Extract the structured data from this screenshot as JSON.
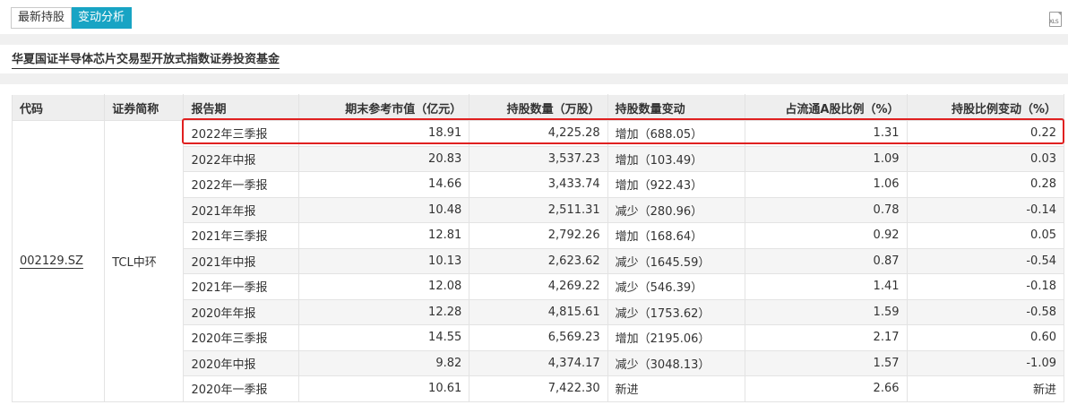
{
  "tabs": [
    "最新持股",
    "变动分析"
  ],
  "active_tab": 1,
  "export_icon": {
    "name": "xls-export-icon",
    "label": "XLS"
  },
  "fund_title": "华夏国证半导体芯片交易型开放式指数证券投资基金",
  "table": {
    "headers": [
      "代码",
      "证券简称",
      "报告期",
      "期末参考市值（亿元）",
      "持股数量（万股）",
      "持股数量变动",
      "占流通A股比例（%）",
      "持股比例变动（%）"
    ],
    "code": "002129.SZ",
    "name": "TCL中环",
    "rows": [
      {
        "period": "2022年三季报",
        "value": "18.91",
        "shares": "4,225.28",
        "change": "增加（688.05）",
        "ratio": "1.31",
        "ratio_change": "0.22"
      },
      {
        "period": "2022年中报",
        "value": "20.83",
        "shares": "3,537.23",
        "change": "增加（103.49）",
        "ratio": "1.09",
        "ratio_change": "0.03"
      },
      {
        "period": "2022年一季报",
        "value": "14.66",
        "shares": "3,433.74",
        "change": "增加（922.43）",
        "ratio": "1.06",
        "ratio_change": "0.28"
      },
      {
        "period": "2021年年报",
        "value": "10.48",
        "shares": "2,511.31",
        "change": "减少（280.96）",
        "ratio": "0.78",
        "ratio_change": "-0.14"
      },
      {
        "period": "2021年三季报",
        "value": "12.81",
        "shares": "2,792.26",
        "change": "增加（168.64）",
        "ratio": "0.92",
        "ratio_change": "0.05"
      },
      {
        "period": "2021年中报",
        "value": "10.13",
        "shares": "2,623.62",
        "change": "减少（1645.59）",
        "ratio": "0.87",
        "ratio_change": "-0.54"
      },
      {
        "period": "2021年一季报",
        "value": "12.08",
        "shares": "4,269.22",
        "change": "减少（546.39）",
        "ratio": "1.41",
        "ratio_change": "-0.18"
      },
      {
        "period": "2020年年报",
        "value": "12.28",
        "shares": "4,815.61",
        "change": "减少（1753.62）",
        "ratio": "1.59",
        "ratio_change": "-0.58"
      },
      {
        "period": "2020年三季报",
        "value": "14.55",
        "shares": "6,569.23",
        "change": "增加（2195.06）",
        "ratio": "2.17",
        "ratio_change": "0.60"
      },
      {
        "period": "2020年中报",
        "value": "9.82",
        "shares": "4,374.17",
        "change": "减少（3048.13）",
        "ratio": "1.57",
        "ratio_change": "-1.09"
      },
      {
        "period": "2020年一季报",
        "value": "10.61",
        "shares": "7,422.30",
        "change": "新进",
        "ratio": "2.66",
        "ratio_change": "新进"
      }
    ]
  },
  "colors": {
    "accent": "#18a4c4",
    "highlight": "#e02020",
    "header_bg": "#eeeeee",
    "band": "#f0f0f0"
  }
}
